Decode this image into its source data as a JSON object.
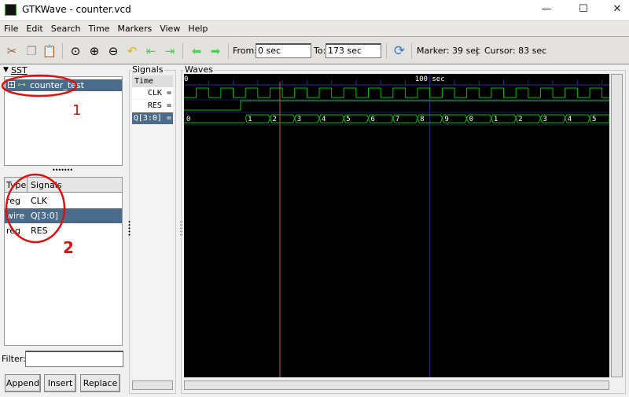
{
  "window": {
    "title": "GTKWave - counter.vcd",
    "minimize": "—",
    "maximize": "☐",
    "close": "✕"
  },
  "menu": [
    "File",
    "Edit",
    "Search",
    "Time",
    "Markers",
    "View",
    "Help"
  ],
  "toolbar": {
    "icons": [
      "cut-icon",
      "copy-icon",
      "paste-icon",
      "zoom-fit-icon",
      "zoom-in-icon",
      "zoom-out-icon",
      "undo-zoom-icon",
      "go-start-icon",
      "go-end-icon",
      "prev-edge-icon",
      "next-edge-icon",
      "reload-icon"
    ],
    "from_label": "From:",
    "from_value": "0 sec",
    "to_label": "To:",
    "to_value": "173 sec",
    "marker": "Marker: 39 sec",
    "divider": "|",
    "cursor": "Cursor: 83 sec"
  },
  "sst": {
    "label": "SST",
    "tree": [
      {
        "name": "counter_test",
        "expand": "+"
      }
    ]
  },
  "signal_list": {
    "headers": [
      "Type",
      "Signals"
    ],
    "rows": [
      {
        "type": "reg",
        "name": "CLK"
      },
      {
        "type": "wire",
        "name": "Q[3:0]"
      },
      {
        "type": "reg",
        "name": "RES"
      }
    ],
    "selected": 1
  },
  "filter": {
    "label": "Filter:",
    "value": ""
  },
  "buttons": {
    "append": "Append",
    "insert": "Insert",
    "replace": "Replace"
  },
  "signals_panel": {
    "label": "Signals",
    "rows": [
      "Time",
      "CLK =",
      "RES =",
      "Q[3:0] ="
    ],
    "selected": 3
  },
  "waves": {
    "label": "Waves",
    "time_range": [
      0,
      173
    ],
    "unit": "sec",
    "start_label": "0",
    "tick_label": "100 sec",
    "tick_label_time": 100,
    "marker_time": 39,
    "colors": {
      "trace": "#00c000",
      "marker": "#d05050",
      "grid": "#2a2a9a",
      "background": "#000000"
    },
    "clk": {
      "period": 10,
      "first_rise": 5
    },
    "res": {
      "rise": 23
    },
    "q": {
      "transitions": [
        0,
        25,
        35,
        45,
        55,
        65,
        75,
        85,
        95,
        105,
        115,
        125,
        135,
        145,
        155,
        165
      ],
      "values": [
        "0",
        "1",
        "2",
        "3",
        "4",
        "5",
        "6",
        "7",
        "8",
        "9",
        "0",
        "1",
        "2",
        "3",
        "4",
        "5"
      ]
    }
  },
  "annotations": {
    "one": "1",
    "two": "2",
    "color": "#e01010"
  }
}
